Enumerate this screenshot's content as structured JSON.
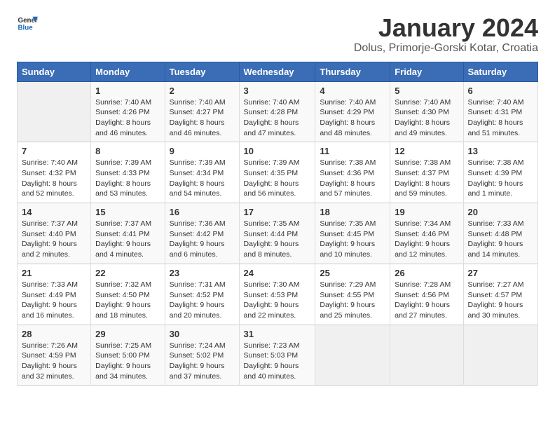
{
  "header": {
    "logo_general": "General",
    "logo_blue": "Blue",
    "month_title": "January 2024",
    "subtitle": "Dolus, Primorje-Gorski Kotar, Croatia"
  },
  "days_of_week": [
    "Sunday",
    "Monday",
    "Tuesday",
    "Wednesday",
    "Thursday",
    "Friday",
    "Saturday"
  ],
  "weeks": [
    [
      {
        "day": "",
        "info": ""
      },
      {
        "day": "1",
        "info": "Sunrise: 7:40 AM\nSunset: 4:26 PM\nDaylight: 8 hours\nand 46 minutes."
      },
      {
        "day": "2",
        "info": "Sunrise: 7:40 AM\nSunset: 4:27 PM\nDaylight: 8 hours\nand 46 minutes."
      },
      {
        "day": "3",
        "info": "Sunrise: 7:40 AM\nSunset: 4:28 PM\nDaylight: 8 hours\nand 47 minutes."
      },
      {
        "day": "4",
        "info": "Sunrise: 7:40 AM\nSunset: 4:29 PM\nDaylight: 8 hours\nand 48 minutes."
      },
      {
        "day": "5",
        "info": "Sunrise: 7:40 AM\nSunset: 4:30 PM\nDaylight: 8 hours\nand 49 minutes."
      },
      {
        "day": "6",
        "info": "Sunrise: 7:40 AM\nSunset: 4:31 PM\nDaylight: 8 hours\nand 51 minutes."
      }
    ],
    [
      {
        "day": "7",
        "info": "Sunrise: 7:40 AM\nSunset: 4:32 PM\nDaylight: 8 hours\nand 52 minutes."
      },
      {
        "day": "8",
        "info": "Sunrise: 7:39 AM\nSunset: 4:33 PM\nDaylight: 8 hours\nand 53 minutes."
      },
      {
        "day": "9",
        "info": "Sunrise: 7:39 AM\nSunset: 4:34 PM\nDaylight: 8 hours\nand 54 minutes."
      },
      {
        "day": "10",
        "info": "Sunrise: 7:39 AM\nSunset: 4:35 PM\nDaylight: 8 hours\nand 56 minutes."
      },
      {
        "day": "11",
        "info": "Sunrise: 7:38 AM\nSunset: 4:36 PM\nDaylight: 8 hours\nand 57 minutes."
      },
      {
        "day": "12",
        "info": "Sunrise: 7:38 AM\nSunset: 4:37 PM\nDaylight: 8 hours\nand 59 minutes."
      },
      {
        "day": "13",
        "info": "Sunrise: 7:38 AM\nSunset: 4:39 PM\nDaylight: 9 hours\nand 1 minute."
      }
    ],
    [
      {
        "day": "14",
        "info": "Sunrise: 7:37 AM\nSunset: 4:40 PM\nDaylight: 9 hours\nand 2 minutes."
      },
      {
        "day": "15",
        "info": "Sunrise: 7:37 AM\nSunset: 4:41 PM\nDaylight: 9 hours\nand 4 minutes."
      },
      {
        "day": "16",
        "info": "Sunrise: 7:36 AM\nSunset: 4:42 PM\nDaylight: 9 hours\nand 6 minutes."
      },
      {
        "day": "17",
        "info": "Sunrise: 7:35 AM\nSunset: 4:44 PM\nDaylight: 9 hours\nand 8 minutes."
      },
      {
        "day": "18",
        "info": "Sunrise: 7:35 AM\nSunset: 4:45 PM\nDaylight: 9 hours\nand 10 minutes."
      },
      {
        "day": "19",
        "info": "Sunrise: 7:34 AM\nSunset: 4:46 PM\nDaylight: 9 hours\nand 12 minutes."
      },
      {
        "day": "20",
        "info": "Sunrise: 7:33 AM\nSunset: 4:48 PM\nDaylight: 9 hours\nand 14 minutes."
      }
    ],
    [
      {
        "day": "21",
        "info": "Sunrise: 7:33 AM\nSunset: 4:49 PM\nDaylight: 9 hours\nand 16 minutes."
      },
      {
        "day": "22",
        "info": "Sunrise: 7:32 AM\nSunset: 4:50 PM\nDaylight: 9 hours\nand 18 minutes."
      },
      {
        "day": "23",
        "info": "Sunrise: 7:31 AM\nSunset: 4:52 PM\nDaylight: 9 hours\nand 20 minutes."
      },
      {
        "day": "24",
        "info": "Sunrise: 7:30 AM\nSunset: 4:53 PM\nDaylight: 9 hours\nand 22 minutes."
      },
      {
        "day": "25",
        "info": "Sunrise: 7:29 AM\nSunset: 4:55 PM\nDaylight: 9 hours\nand 25 minutes."
      },
      {
        "day": "26",
        "info": "Sunrise: 7:28 AM\nSunset: 4:56 PM\nDaylight: 9 hours\nand 27 minutes."
      },
      {
        "day": "27",
        "info": "Sunrise: 7:27 AM\nSunset: 4:57 PM\nDaylight: 9 hours\nand 30 minutes."
      }
    ],
    [
      {
        "day": "28",
        "info": "Sunrise: 7:26 AM\nSunset: 4:59 PM\nDaylight: 9 hours\nand 32 minutes."
      },
      {
        "day": "29",
        "info": "Sunrise: 7:25 AM\nSunset: 5:00 PM\nDaylight: 9 hours\nand 34 minutes."
      },
      {
        "day": "30",
        "info": "Sunrise: 7:24 AM\nSunset: 5:02 PM\nDaylight: 9 hours\nand 37 minutes."
      },
      {
        "day": "31",
        "info": "Sunrise: 7:23 AM\nSunset: 5:03 PM\nDaylight: 9 hours\nand 40 minutes."
      },
      {
        "day": "",
        "info": ""
      },
      {
        "day": "",
        "info": ""
      },
      {
        "day": "",
        "info": ""
      }
    ]
  ]
}
